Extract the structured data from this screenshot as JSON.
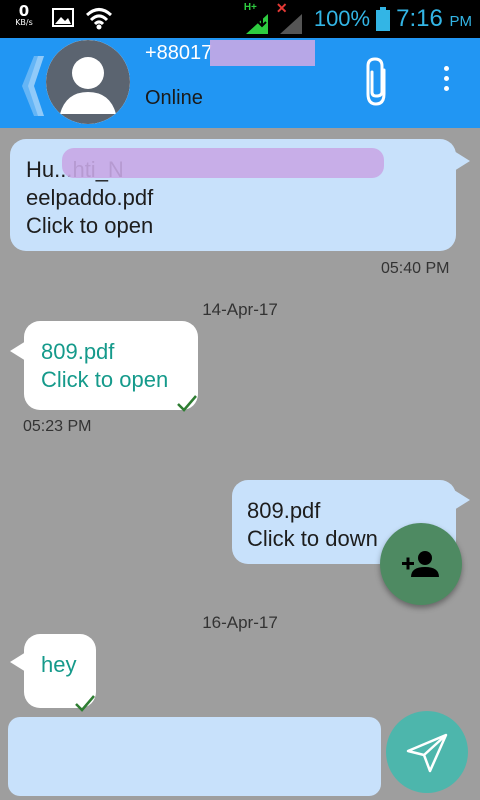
{
  "status_bar": {
    "data_speed_value": "0",
    "data_speed_unit": "KB/s",
    "network_type": "H+",
    "battery_percent": "100%",
    "time": "7:16",
    "time_suffix": "PM"
  },
  "header": {
    "contact_number": "+88017",
    "contact_status": "Online"
  },
  "messages": [
    {
      "direction": "outgoing",
      "text": "Hu...hti_N\neelpaddo.pdf\nClick to open",
      "time": "05:40 PM"
    },
    {
      "date": "14-Apr-17"
    },
    {
      "direction": "incoming",
      "text": "809.pdf\nClick to open",
      "time": "05:23 PM",
      "delivered": true
    },
    {
      "direction": "outgoing",
      "text": "809.pdf\nClick to down"
    },
    {
      "date": "16-Apr-17"
    },
    {
      "direction": "incoming",
      "text": "hey",
      "delivered": true
    }
  ],
  "composer": {
    "placeholder": ""
  },
  "icons": {
    "back": "chevron-left-icon",
    "attach": "paperclip-icon",
    "menu": "more-vert-icon",
    "add_contact": "person-add-icon",
    "send": "send-icon"
  },
  "colors": {
    "appbar": "#2196f3",
    "background": "#9e9e9e",
    "outgoing_bubble": "#c8e1fb",
    "incoming_bubble": "#ffffff",
    "incoming_text": "#159a8b",
    "fab": "#4e8a62",
    "send_button": "#4db6ac"
  }
}
